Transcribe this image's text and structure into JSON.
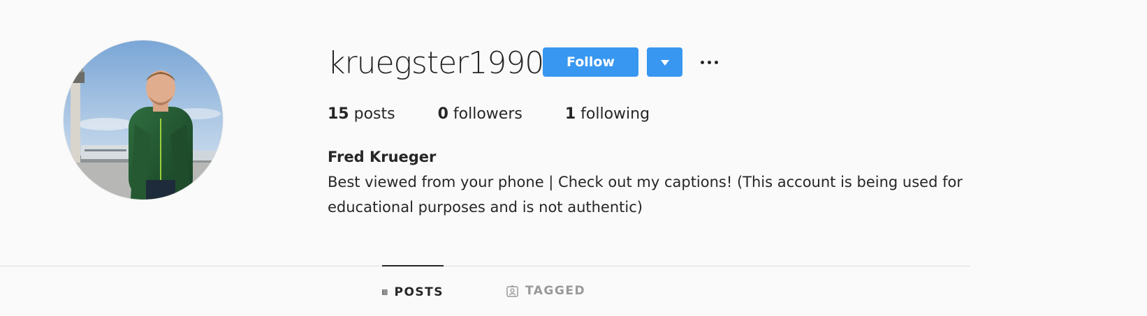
{
  "profile": {
    "username": "kruegster1990",
    "full_name": "Fred Krueger",
    "bio": "Best viewed from your phone | Check out my captions! (This account is being used for educational purposes and is not authentic)",
    "avatar_icon": "profile-photo"
  },
  "actions": {
    "follow_label": "Follow",
    "dropdown_icon": "caret-down-icon",
    "more_icon": "more-options-icon"
  },
  "stats": {
    "posts_count": "15",
    "posts_label": "posts",
    "followers_count": "0",
    "followers_label": "followers",
    "following_count": "1",
    "following_label": "following"
  },
  "tabs": [
    {
      "label": "POSTS",
      "icon": "grid-icon",
      "active": true
    },
    {
      "label": "TAGGED",
      "icon": "tagged-icon",
      "active": false
    }
  ],
  "colors": {
    "accent": "#3897f0",
    "text": "#262626",
    "muted": "#999999",
    "background": "#fafafa"
  }
}
